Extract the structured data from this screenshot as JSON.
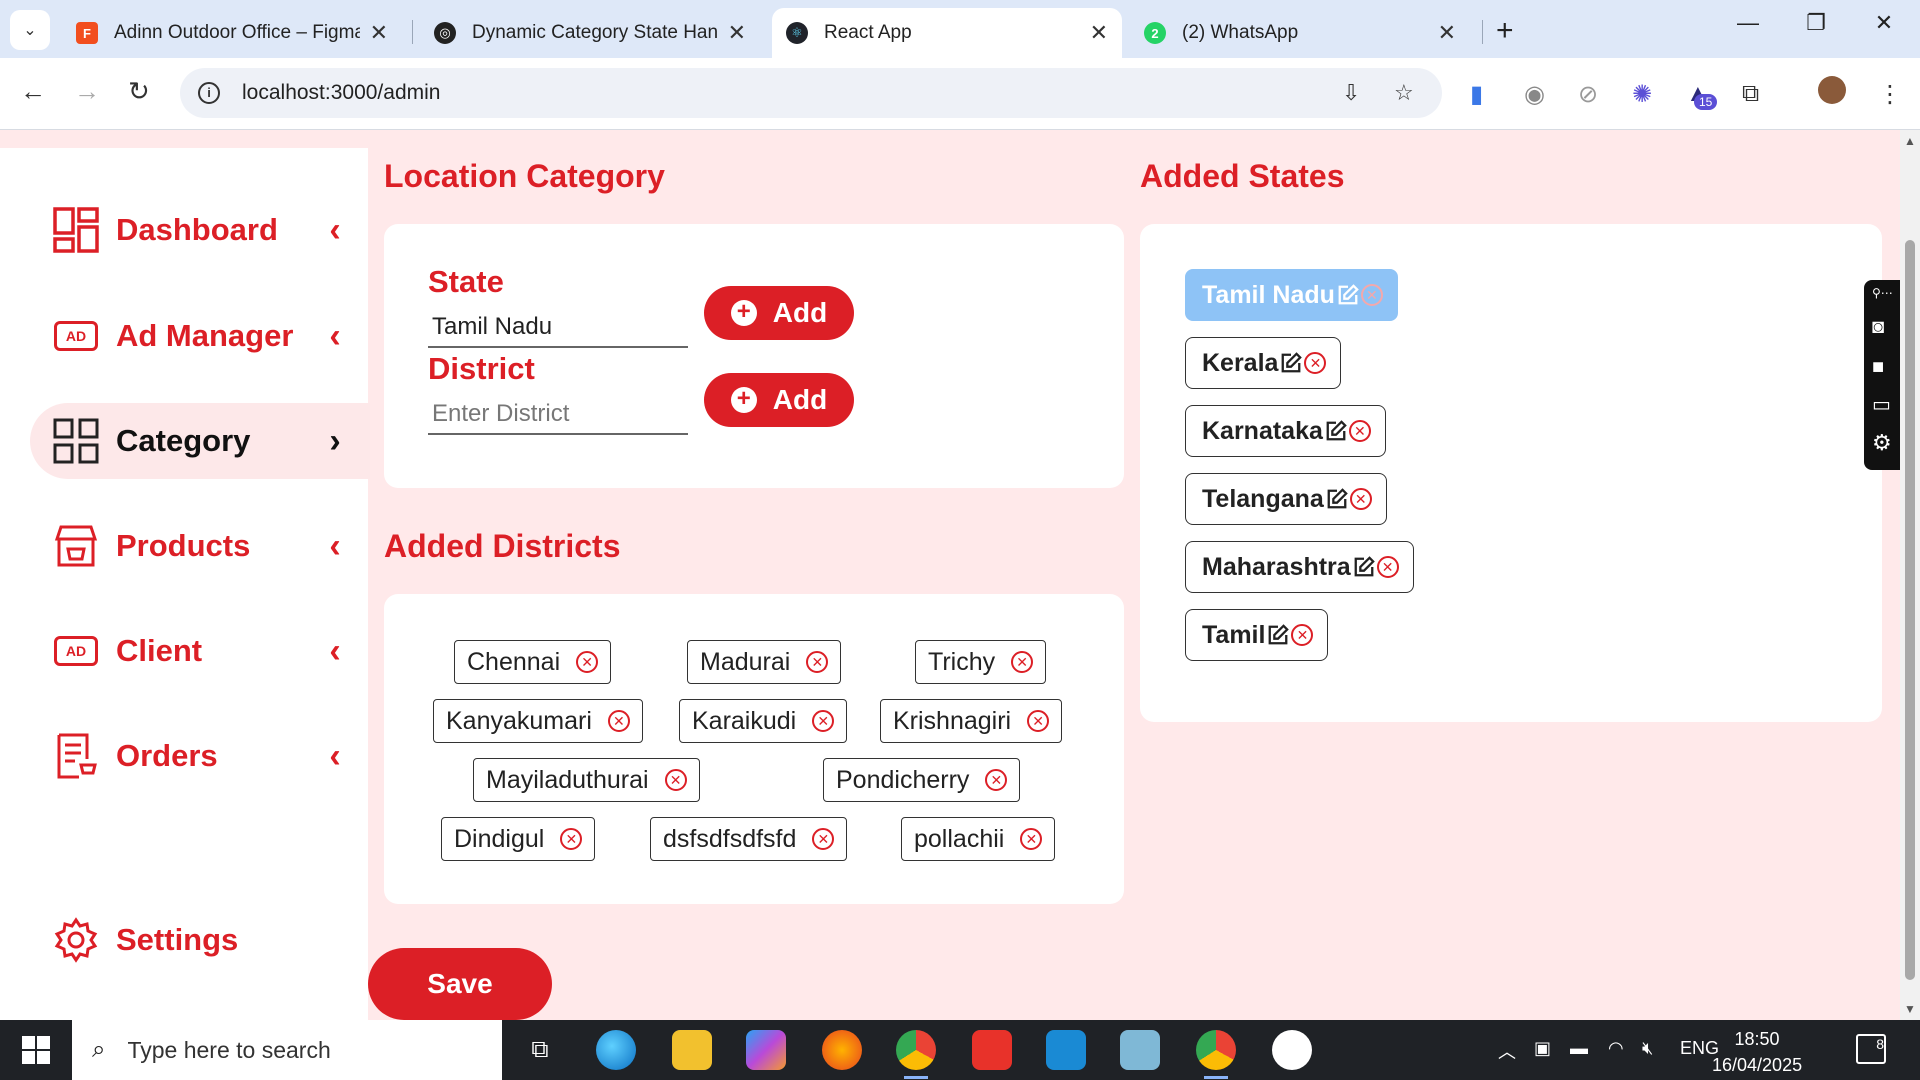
{
  "browser": {
    "tabs": [
      {
        "title": "Adinn Outdoor Office – Figma",
        "icon": "figma-icon"
      },
      {
        "title": "Dynamic Category State Handli",
        "icon": "chatgpt-icon"
      },
      {
        "title": "React App",
        "icon": "react-icon",
        "active": true
      },
      {
        "title": "(2) WhatsApp",
        "icon": "whatsapp-icon",
        "badge": "2"
      }
    ],
    "url": "localhost:3000/admin",
    "extension_badge": "15"
  },
  "sidebar": {
    "items": [
      {
        "label": "Dashboard",
        "icon": "dashboard-grid-icon"
      },
      {
        "label": "Ad Manager",
        "icon": "ad-icon"
      },
      {
        "label": "Category",
        "icon": "category-grid-icon",
        "active": true
      },
      {
        "label": "Products",
        "icon": "store-icon"
      },
      {
        "label": "Client",
        "icon": "ad-icon"
      },
      {
        "label": "Orders",
        "icon": "orders-cart-icon"
      }
    ],
    "settings_label": "Settings"
  },
  "location_category": {
    "title": "Location Category",
    "state_label": "State",
    "state_value": "Tamil Nadu",
    "district_label": "District",
    "district_placeholder": "Enter District",
    "add_label": "Add"
  },
  "added_districts": {
    "title": "Added Districts",
    "items": [
      "Chennai",
      "Madurai",
      "Trichy",
      "Kanyakumari",
      "Karaikudi",
      "Krishnagiri",
      "Mayiladuthurai",
      "Pondicherry",
      "Dindigul",
      "dsfsdfsdfsfd",
      "pollachii"
    ]
  },
  "added_states": {
    "title": "Added States",
    "items": [
      "Tamil Nadu",
      "Kerala",
      "Karnataka",
      "Telangana",
      "Maharashtra",
      "Tamil"
    ],
    "selected": "Tamil Nadu"
  },
  "save_label": "Save",
  "taskbar": {
    "search_placeholder": "Type here to search",
    "language": "ENG",
    "time": "18:50",
    "date": "16/04/2025",
    "notifications": "8"
  },
  "colors": {
    "accent": "#dc1f26",
    "selected_state": "#8ec3f6",
    "background": "#ffe9ea"
  }
}
